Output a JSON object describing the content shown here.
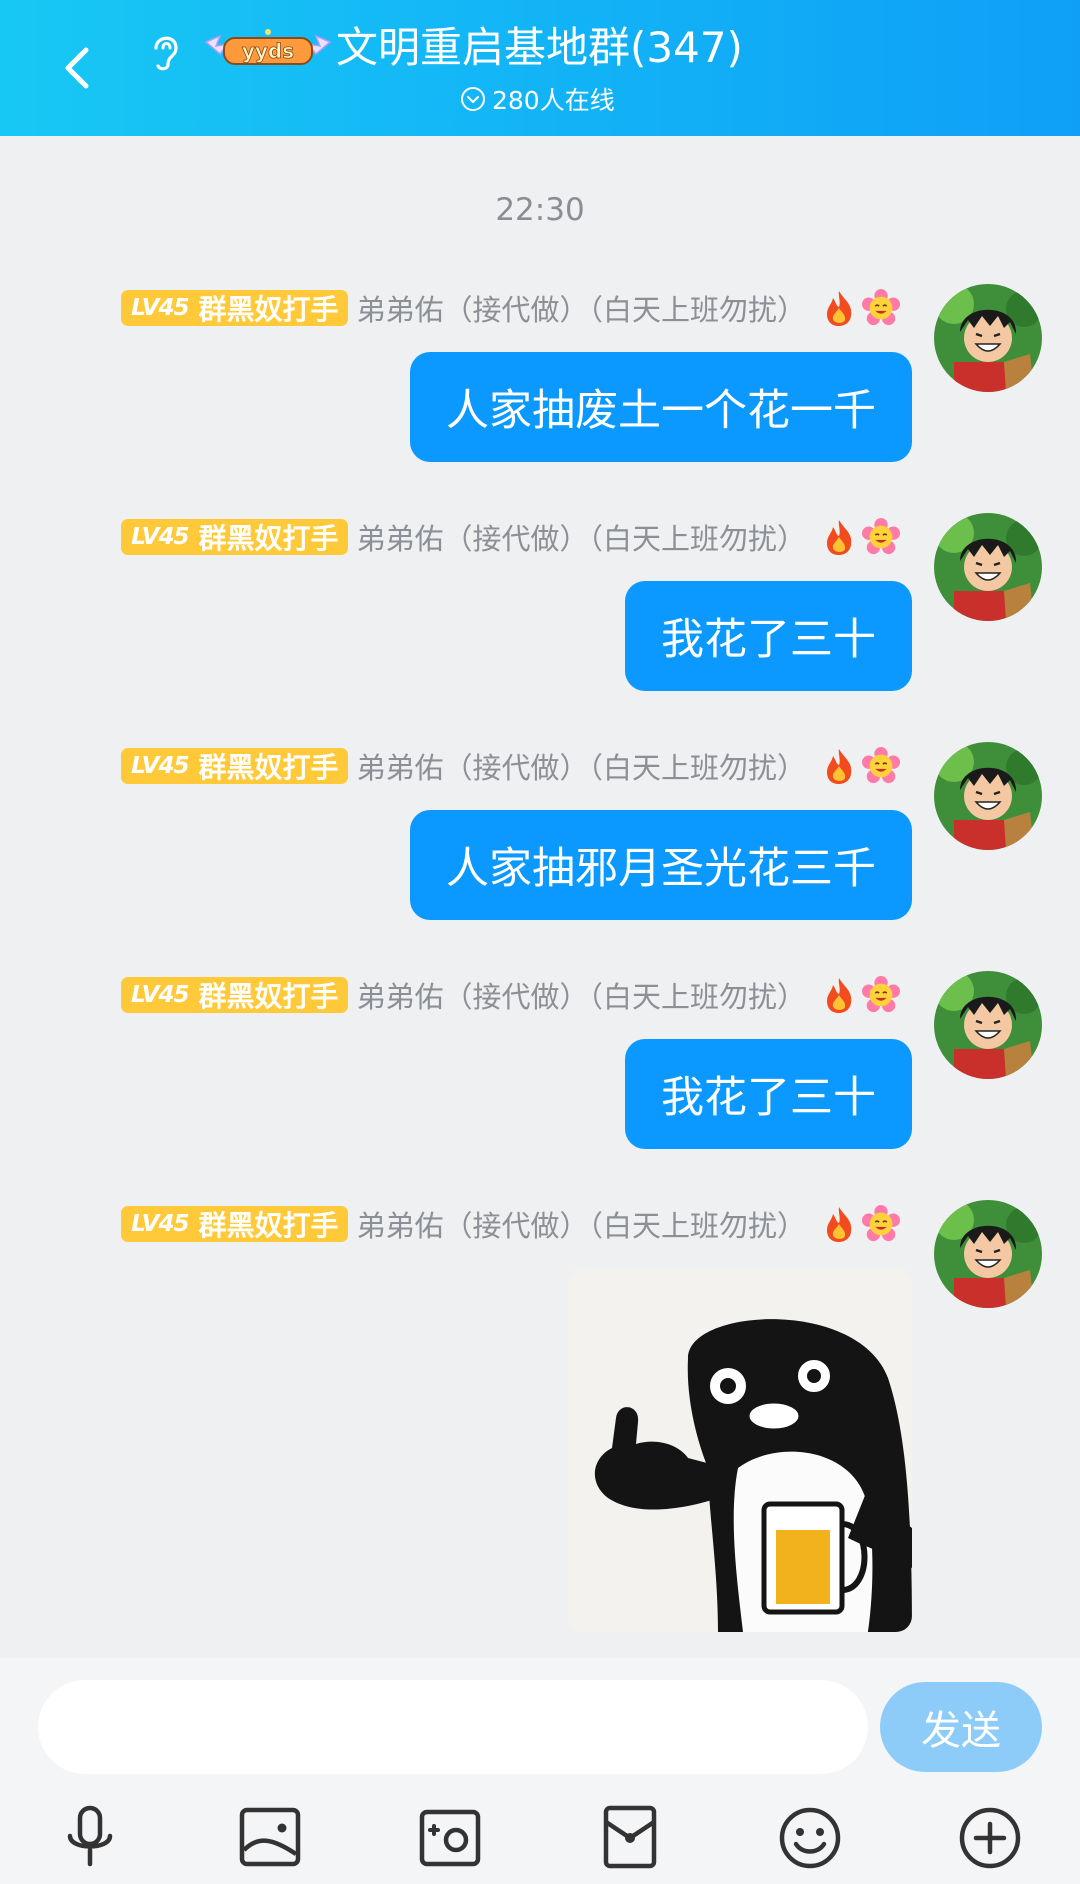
{
  "header": {
    "badge_text": "yyds",
    "title": "文明重启基地群(347)",
    "online": "280人在线"
  },
  "chat": {
    "time": "22:30",
    "messages": [
      {
        "level": "LV45",
        "title_tag": "群黑奴打手",
        "sender": "弟弟佑（接代做）（白天上班勿扰）",
        "type": "text",
        "text": "人家抽废土一个花一千"
      },
      {
        "level": "LV45",
        "title_tag": "群黑奴打手",
        "sender": "弟弟佑（接代做）（白天上班勿扰）",
        "type": "text",
        "text": "我花了三十"
      },
      {
        "level": "LV45",
        "title_tag": "群黑奴打手",
        "sender": "弟弟佑（接代做）（白天上班勿扰）",
        "type": "text",
        "text": "人家抽邪月圣光花三千"
      },
      {
        "level": "LV45",
        "title_tag": "群黑奴打手",
        "sender": "弟弟佑（接代做）（白天上班勿扰）",
        "type": "text",
        "text": "我花了三十"
      },
      {
        "level": "LV45",
        "title_tag": "群黑奴打手",
        "sender": "弟弟佑（接代做）（白天上班勿扰）",
        "type": "sticker",
        "sticker": "penguin-thumbs-up-beer"
      }
    ]
  },
  "input": {
    "placeholder": "",
    "value": "",
    "send_label": "发送"
  },
  "toolbar": [
    "microphone-icon",
    "image-icon",
    "camera-icon",
    "red-packet-icon",
    "emoji-icon",
    "plus-icon"
  ],
  "colors": {
    "header_start": "#18c8f4",
    "header_end": "#0f9ff7",
    "bubble": "#0b99ff",
    "level_tag": "#ffc93a",
    "send_button": "#8dccf8",
    "background": "#eff0f2"
  }
}
